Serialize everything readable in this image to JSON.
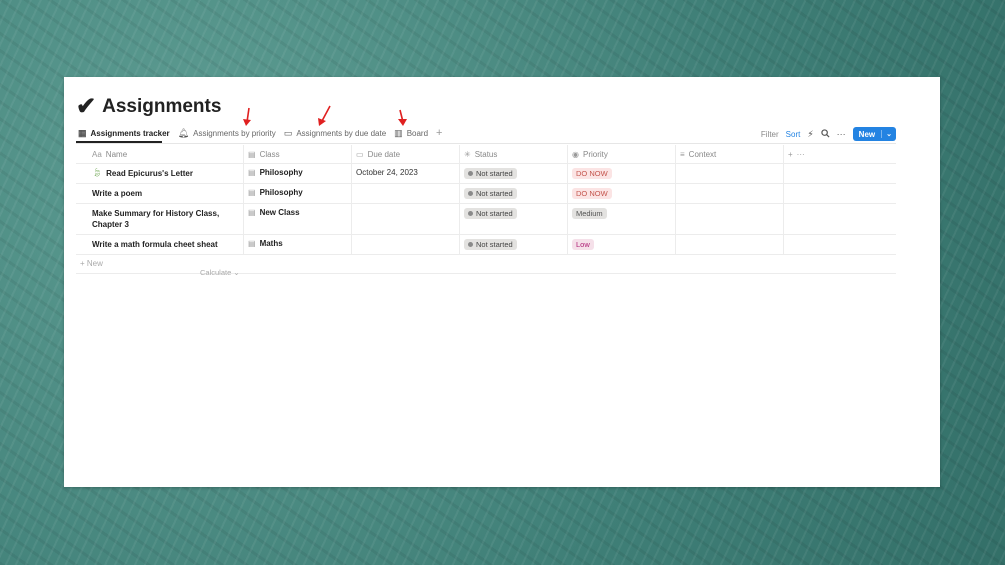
{
  "page": {
    "title": "Assignments",
    "title_icon": "checkmark-icon"
  },
  "tabs": [
    {
      "label": "Assignments tracker",
      "icon": "table-icon",
      "active": true
    },
    {
      "label": "Assignments by priority",
      "icon": "bell-icon",
      "active": false
    },
    {
      "label": "Assignments by due date",
      "icon": "calendar-icon",
      "active": false
    },
    {
      "label": "Board",
      "icon": "board-icon",
      "active": false
    }
  ],
  "toolbar": {
    "filter_label": "Filter",
    "sort_label": "Sort",
    "new_label": "New"
  },
  "table": {
    "headers": {
      "name": "Name",
      "name_prefix": "Aa",
      "class": "Class",
      "due_date": "Due date",
      "status": "Status",
      "priority": "Priority",
      "context": "Context"
    },
    "rows": [
      {
        "name": "Read Epicurus's Letter",
        "has_icon": true,
        "class": "Philosophy",
        "due": "October 24, 2023",
        "status": "Not started",
        "priority": "DO NOW",
        "priority_color": "#fbe4e4",
        "priority_text": "#c4554d"
      },
      {
        "name": "Write a poem",
        "has_icon": false,
        "class": "Philosophy",
        "due": "",
        "status": "Not started",
        "priority": "DO NOW",
        "priority_color": "#fbe4e4",
        "priority_text": "#c4554d"
      },
      {
        "name": "Make Summary for History Class, Chapter 3",
        "has_icon": false,
        "class": "New Class",
        "due": "",
        "status": "Not started",
        "priority": "Medium",
        "priority_color": "#e3e2e0",
        "priority_text": "#555555"
      },
      {
        "name": "Write a math formula cheet sheat",
        "has_icon": false,
        "class": "Maths",
        "due": "",
        "status": "Not started",
        "priority": "Low",
        "priority_color": "#f5e0e9",
        "priority_text": "#ad1a72"
      }
    ],
    "new_row_label": "+ New",
    "calculate_label": "Calculate"
  },
  "colors": {
    "accent": "#2383e2",
    "background": "#4f8f86",
    "annotation_arrow": "#e02020"
  }
}
